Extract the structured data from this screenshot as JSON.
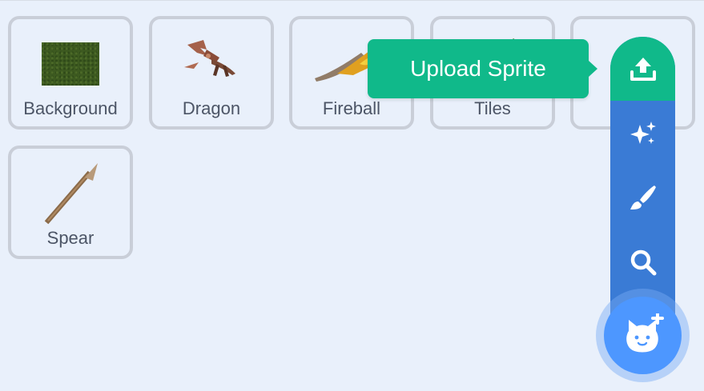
{
  "sprites": [
    {
      "name": "Background",
      "icon": "background-swatch"
    },
    {
      "name": "Dragon",
      "icon": "dragon-sprite-icon"
    },
    {
      "name": "Fireball",
      "icon": "fireball-sprite-icon"
    },
    {
      "name": "Tiles",
      "icon": "tiles-sprite-icon"
    },
    {
      "name": "",
      "icon": "partially-hidden-sprite-icon"
    },
    {
      "name": "Spear",
      "icon": "spear-sprite-icon"
    }
  ],
  "tooltip": {
    "text": "Upload Sprite"
  },
  "menu": {
    "items": [
      {
        "icon": "upload-icon",
        "active": true
      },
      {
        "icon": "surprise-sparkle-icon",
        "active": false
      },
      {
        "icon": "paint-brush-icon",
        "active": false
      },
      {
        "icon": "search-icon",
        "active": false
      }
    ],
    "fab_icon": "cat-plus-icon"
  },
  "colors": {
    "background": "#e9f0fb",
    "tile_border": "#c9ced8",
    "menu_blue": "#3a7bd5",
    "active_green": "#10b98a",
    "fab_blue": "#4d97ff"
  }
}
